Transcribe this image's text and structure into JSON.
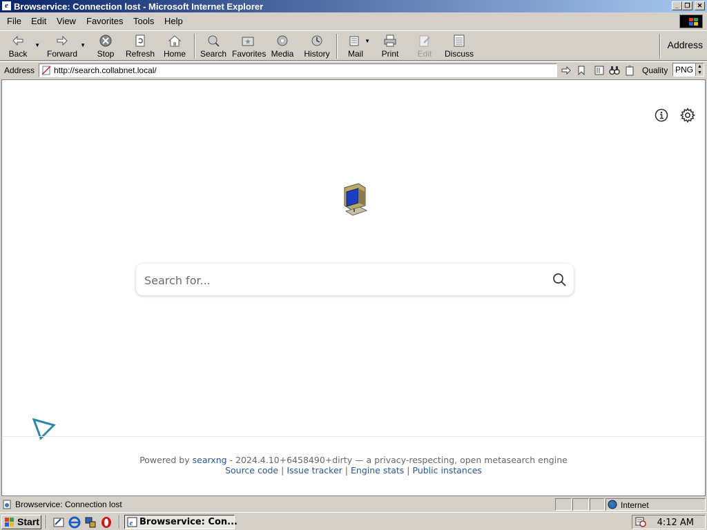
{
  "window": {
    "title": "Browservice: Connection lost - Microsoft Internet Explorer"
  },
  "menu": [
    "File",
    "Edit",
    "View",
    "Favorites",
    "Tools",
    "Help"
  ],
  "toolbar": {
    "back": "Back",
    "forward": "Forward",
    "stop": "Stop",
    "refresh": "Refresh",
    "home": "Home",
    "search": "Search",
    "favorites": "Favorites",
    "media": "Media",
    "history": "History",
    "mail": "Mail",
    "print": "Print",
    "edit": "Edit",
    "discuss": "Discuss",
    "address_label": "Address"
  },
  "address_bar": {
    "label": "Address",
    "url": "http://search.collabnet.local/",
    "quality_label": "Quality",
    "quality_value": "PNG"
  },
  "page": {
    "search_placeholder": "Search for...",
    "footer": {
      "powered_by": "Powered by",
      "searxng": "searxng",
      "version_text": "- 2024.4.10+6458490+dirty — a privacy-respecting, open metasearch engine",
      "source_code": "Source code",
      "issue_tracker": "Issue tracker",
      "engine_stats": "Engine stats",
      "public_instances": "Public instances",
      "separator": "|"
    }
  },
  "statusbar": {
    "text": "Browservice: Connection lost",
    "zone": "Internet"
  },
  "taskbar": {
    "start": "Start",
    "task_label": "Browservice: Con...",
    "clock": "4:12 AM"
  },
  "colors": {
    "titlebar_start": "#0a246a",
    "titlebar_end": "#a6caf0",
    "link": "#2a5598",
    "chrome": "#d4d0c8"
  }
}
